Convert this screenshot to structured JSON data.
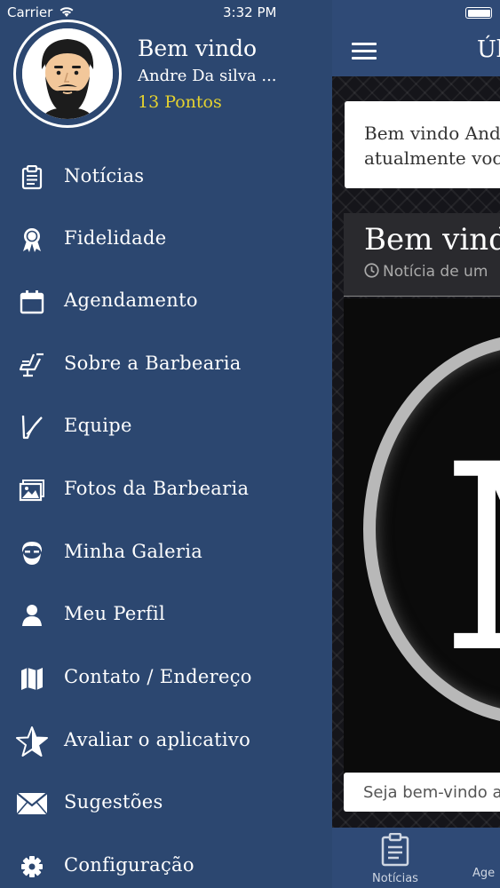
{
  "status": {
    "carrier": "Carrier",
    "time": "3:32 PM"
  },
  "drawer": {
    "greeting": "Bem vindo",
    "user_name": "Andre Da silva ...",
    "points": "13 Pontos",
    "items": [
      {
        "label": "Notícias",
        "icon": "clipboard-icon"
      },
      {
        "label": "Fidelidade",
        "icon": "ribbon-icon"
      },
      {
        "label": "Agendamento",
        "icon": "calendar-icon"
      },
      {
        "label": "Sobre a Barbearia",
        "icon": "barber-chair-icon"
      },
      {
        "label": "Equipe",
        "icon": "razor-icon"
      },
      {
        "label": "Fotos da Barbearia",
        "icon": "photos-icon"
      },
      {
        "label": "Minha Galeria",
        "icon": "bearded-face-icon"
      },
      {
        "label": "Meu Perfil",
        "icon": "user-icon"
      },
      {
        "label": "Contato / Endereço",
        "icon": "map-icon"
      },
      {
        "label": "Avaliar o aplicativo",
        "icon": "star-icon"
      },
      {
        "label": "Sugestões",
        "icon": "envelope-icon"
      },
      {
        "label": "Configuração",
        "icon": "gear-icon"
      }
    ]
  },
  "app": {
    "nav_title": "Úl",
    "welcome_text_line1": "Bem vindo And",
    "welcome_text_line2": "atualmente voc",
    "post_title": "Bem vind",
    "post_subtitle": "Notícia de um",
    "logo_letter": "M",
    "post_caption": "Seja bem-vindo a",
    "tabs": [
      {
        "label": "Notícias"
      },
      {
        "label": "Age"
      }
    ]
  },
  "colors": {
    "drawer_bg": "#2c4770",
    "nav_bg": "#2f4a76",
    "points": "#e5d22f"
  }
}
